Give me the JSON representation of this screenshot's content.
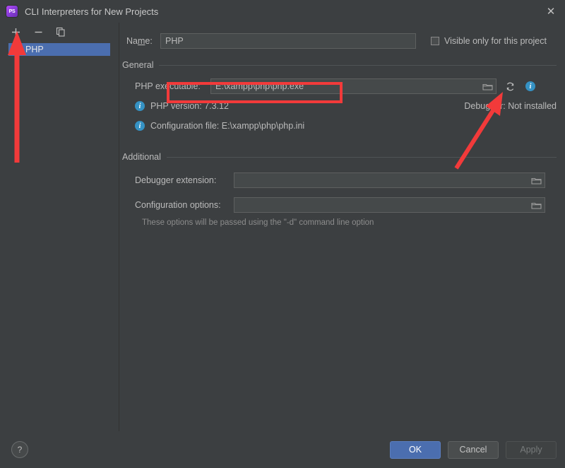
{
  "window": {
    "title": "CLI Interpreters for New Projects",
    "app_icon": "phpstorm-logo-icon",
    "close_icon": "close-icon"
  },
  "sidebar": {
    "toolbar": [
      {
        "name": "add",
        "icon": "plus-icon",
        "tooltip": "Add"
      },
      {
        "name": "remove",
        "icon": "minus-icon",
        "tooltip": "Remove"
      },
      {
        "name": "duplicate",
        "icon": "copy-icon",
        "tooltip": "Duplicate"
      }
    ],
    "items": [
      {
        "label": "PHP",
        "selected": true
      }
    ]
  },
  "form": {
    "name": {
      "label": "Name:",
      "label_pre": "Na",
      "label_mnemonic": "m",
      "label_post": "e:",
      "value": "PHP",
      "placeholder": ""
    },
    "visible_only": {
      "label": "Visible only for this project",
      "checked": false
    }
  },
  "general": {
    "title": "General",
    "php_executable": {
      "label": "PHP executable:",
      "value": "E:\\xampp\\php\\php.exe",
      "placeholder": "",
      "browse_icon": "folder-browse-icon",
      "refresh_icon": "refresh-icon",
      "info_icon": "info-icon"
    },
    "php_version": {
      "icon": "info-icon",
      "text": "PHP version: 7.3.12"
    },
    "config_file": {
      "icon": "info-icon",
      "text": "Configuration file: E:\\xampp\\php\\php.ini"
    },
    "debugger_status": "Debugger: Not installed"
  },
  "additional": {
    "title": "Additional",
    "debugger_extension": {
      "label": "Debugger extension:",
      "value": "",
      "placeholder": "",
      "browse_icon": "folder-browse-icon"
    },
    "configuration_options": {
      "label": "Configuration options:",
      "value": "",
      "placeholder": "",
      "browse_icon": "folder-browse-icon"
    },
    "hint": "These options will be passed using the \"-d\" command line option"
  },
  "footer": {
    "help_label": "?",
    "ok_label": "OK",
    "cancel_label": "Cancel",
    "apply_label": "Apply",
    "apply_enabled": false
  },
  "annotations": {
    "highlight_color": "#f23a3a",
    "rect_target": "php-executable-field",
    "arrow_left_target": "add-interpreter-button",
    "arrow_right_target": "php-executable-browse-button"
  }
}
